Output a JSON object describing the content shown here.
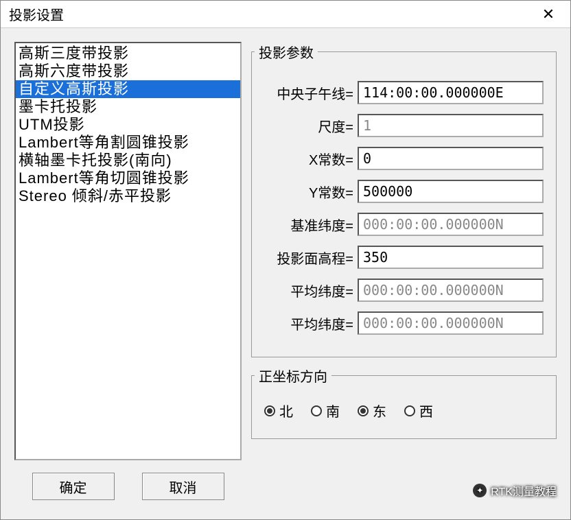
{
  "window": {
    "title": "投影设置"
  },
  "list": {
    "items": [
      "高斯三度带投影",
      "高斯六度带投影",
      "自定义高斯投影",
      "墨卡托投影",
      "UTM投影",
      "Lambert等角割圆锥投影",
      "横轴墨卡托投影(南向)",
      "Lambert等角切圆锥投影",
      "Stereo 倾斜/赤平投影"
    ],
    "selected_index": 2
  },
  "buttons": {
    "ok": "确定",
    "cancel": "取消"
  },
  "params": {
    "legend": "投影参数",
    "rows": [
      {
        "label": "中央子午线=",
        "value": "114:00:00.000000E",
        "disabled": false
      },
      {
        "label": "尺度=",
        "value": "1",
        "disabled": true
      },
      {
        "label": "X常数=",
        "value": "0",
        "disabled": false
      },
      {
        "label": "Y常数=",
        "value": "500000",
        "disabled": false
      },
      {
        "label": "基准纬度=",
        "value": "000:00:00.000000N",
        "disabled": true
      },
      {
        "label": "投影面高程=",
        "value": "350",
        "disabled": false
      },
      {
        "label": "平均纬度=",
        "value": "000:00:00.000000N",
        "disabled": true
      },
      {
        "label": "平均纬度=",
        "value": "000:00:00.000000N",
        "disabled": true
      }
    ]
  },
  "direction": {
    "legend": "正坐标方向",
    "options": [
      {
        "label": "北",
        "checked": true
      },
      {
        "label": "南",
        "checked": false
      },
      {
        "label": "东",
        "checked": true
      },
      {
        "label": "西",
        "checked": false
      }
    ]
  },
  "watermark": "RTK测量教程"
}
